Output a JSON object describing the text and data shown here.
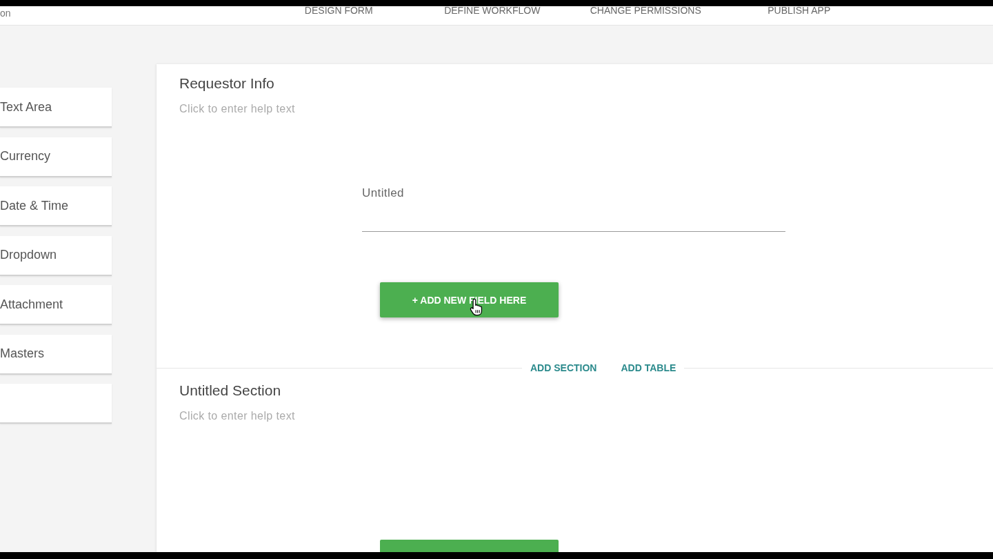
{
  "top_bar": {
    "title_fragment": "on",
    "steps": [
      {
        "label": "DESIGN FORM"
      },
      {
        "label": "DEFINE WORKFLOW"
      },
      {
        "label": "CHANGE PERMISSIONS"
      },
      {
        "label": "PUBLISH APP"
      }
    ]
  },
  "palette": {
    "items": [
      {
        "kind": "field_type",
        "label": "Text Area"
      },
      {
        "kind": "field_type",
        "label": "Currency"
      },
      {
        "kind": "field_type",
        "label": "Date & Time"
      },
      {
        "kind": "field_type",
        "label": "Dropdown"
      },
      {
        "kind": "field_type",
        "label": "Attachment"
      },
      {
        "kind": "field_type",
        "label": "Masters"
      },
      {
        "kind": "blank"
      }
    ]
  },
  "form": {
    "sections": [
      {
        "title": "Requestor Info",
        "help_text": "Click to enter help text",
        "fields": [
          {
            "label": "Untitled"
          }
        ],
        "add_field_button": "+ ADD NEW FIELD HERE",
        "footer_actions": [
          "ADD SECTION",
          "ADD TABLE"
        ]
      },
      {
        "title": "Untitled Section",
        "help_text": "Click to enter help text"
      }
    ]
  }
}
